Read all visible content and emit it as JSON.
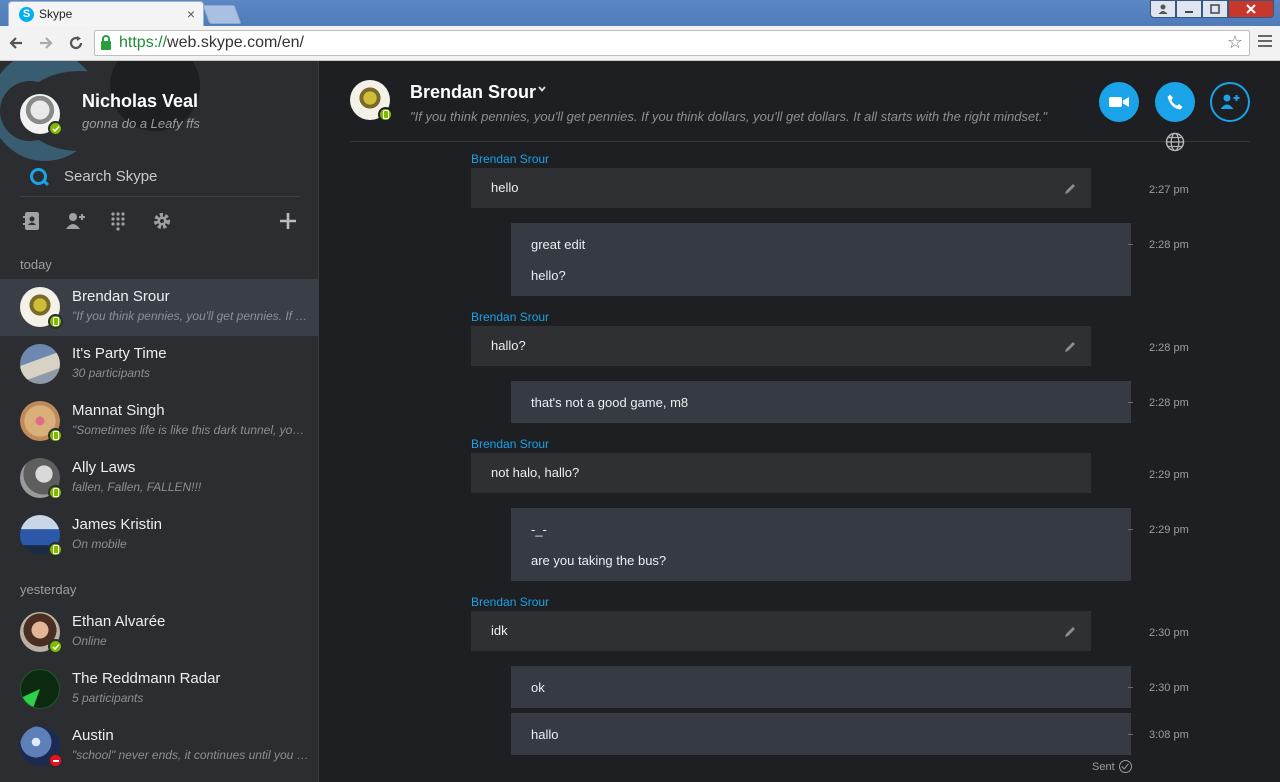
{
  "browser": {
    "tab_title": "Skype",
    "tab_logo": "S",
    "tab_close": "×",
    "url_scheme": "https://",
    "url_rest": "web.skype.com/en/",
    "star_icon": "☆"
  },
  "me": {
    "name": "Nicholas Veal",
    "mood": "gonna do a Leafy ffs",
    "status": "online"
  },
  "search": {
    "placeholder": "Search Skype"
  },
  "tools": [
    "contacts-icon",
    "add-contact-icon",
    "dialpad-icon",
    "settings-icon",
    "add-icon"
  ],
  "sections": {
    "today": "today",
    "yesterday": "yesterday"
  },
  "contacts": [
    {
      "name": "Brendan Srour",
      "sub": "\"If you think pennies, you'll get pennies. If you think dollars, you'll get dollars. It all starts with the right mindset.\"",
      "status": "mobile",
      "active": true
    },
    {
      "name": "It's Party Time",
      "sub": "30 participants",
      "status": "none"
    },
    {
      "name": "Mannat Singh",
      "sub": "\"Sometimes life is like this dark tunnel, you can't always see the light at the end\"",
      "status": "mobile"
    },
    {
      "name": "Ally Laws",
      "sub": "fallen, Fallen, FALLEN!!!",
      "status": "mobile"
    },
    {
      "name": "James Kristin",
      "sub": "On mobile",
      "status": "mobile"
    },
    {
      "name": "Ethan Alvarée",
      "sub": "Online",
      "status": "online"
    },
    {
      "name": "The Reddmann Radar",
      "sub": "5 participants",
      "status": "none"
    },
    {
      "name": "Austin",
      "sub": "\"school\" never ends, it continues until you die",
      "status": "busy"
    }
  ],
  "conversation": {
    "name": "Brendan Srour",
    "chevron": "⌄",
    "mood": "\"If you think pennies, you'll get pennies. If you think dollars, you'll get dollars. It all starts with the right mindset.\"",
    "sender": "Brendan Srour",
    "messages": [
      {
        "lines": [
          "hello"
        ],
        "time": "2:27 pm"
      },
      {
        "lines": [
          "great edit",
          "hello?"
        ],
        "time": "2:28 pm"
      },
      {
        "lines": [
          "hallo?"
        ],
        "time": "2:28 pm"
      },
      {
        "lines": [
          "that's not a good game, m8"
        ],
        "time": "2:28 pm"
      },
      {
        "lines": [
          "not halo, hallo?"
        ],
        "time": "2:29 pm"
      },
      {
        "lines": [
          "-_-",
          "are you taking the bus?"
        ],
        "time": "2:29 pm"
      },
      {
        "lines": [
          "idk"
        ],
        "time": "2:30 pm"
      },
      {
        "lines": [
          "ok"
        ],
        "time": "2:30 pm"
      },
      {
        "lines": [
          "hallo"
        ],
        "time": "3:08 pm"
      }
    ],
    "sent_label": "Sent"
  },
  "colors": {
    "accent": "#1aa3e8",
    "online": "#7fba00",
    "busy": "#e81123"
  }
}
